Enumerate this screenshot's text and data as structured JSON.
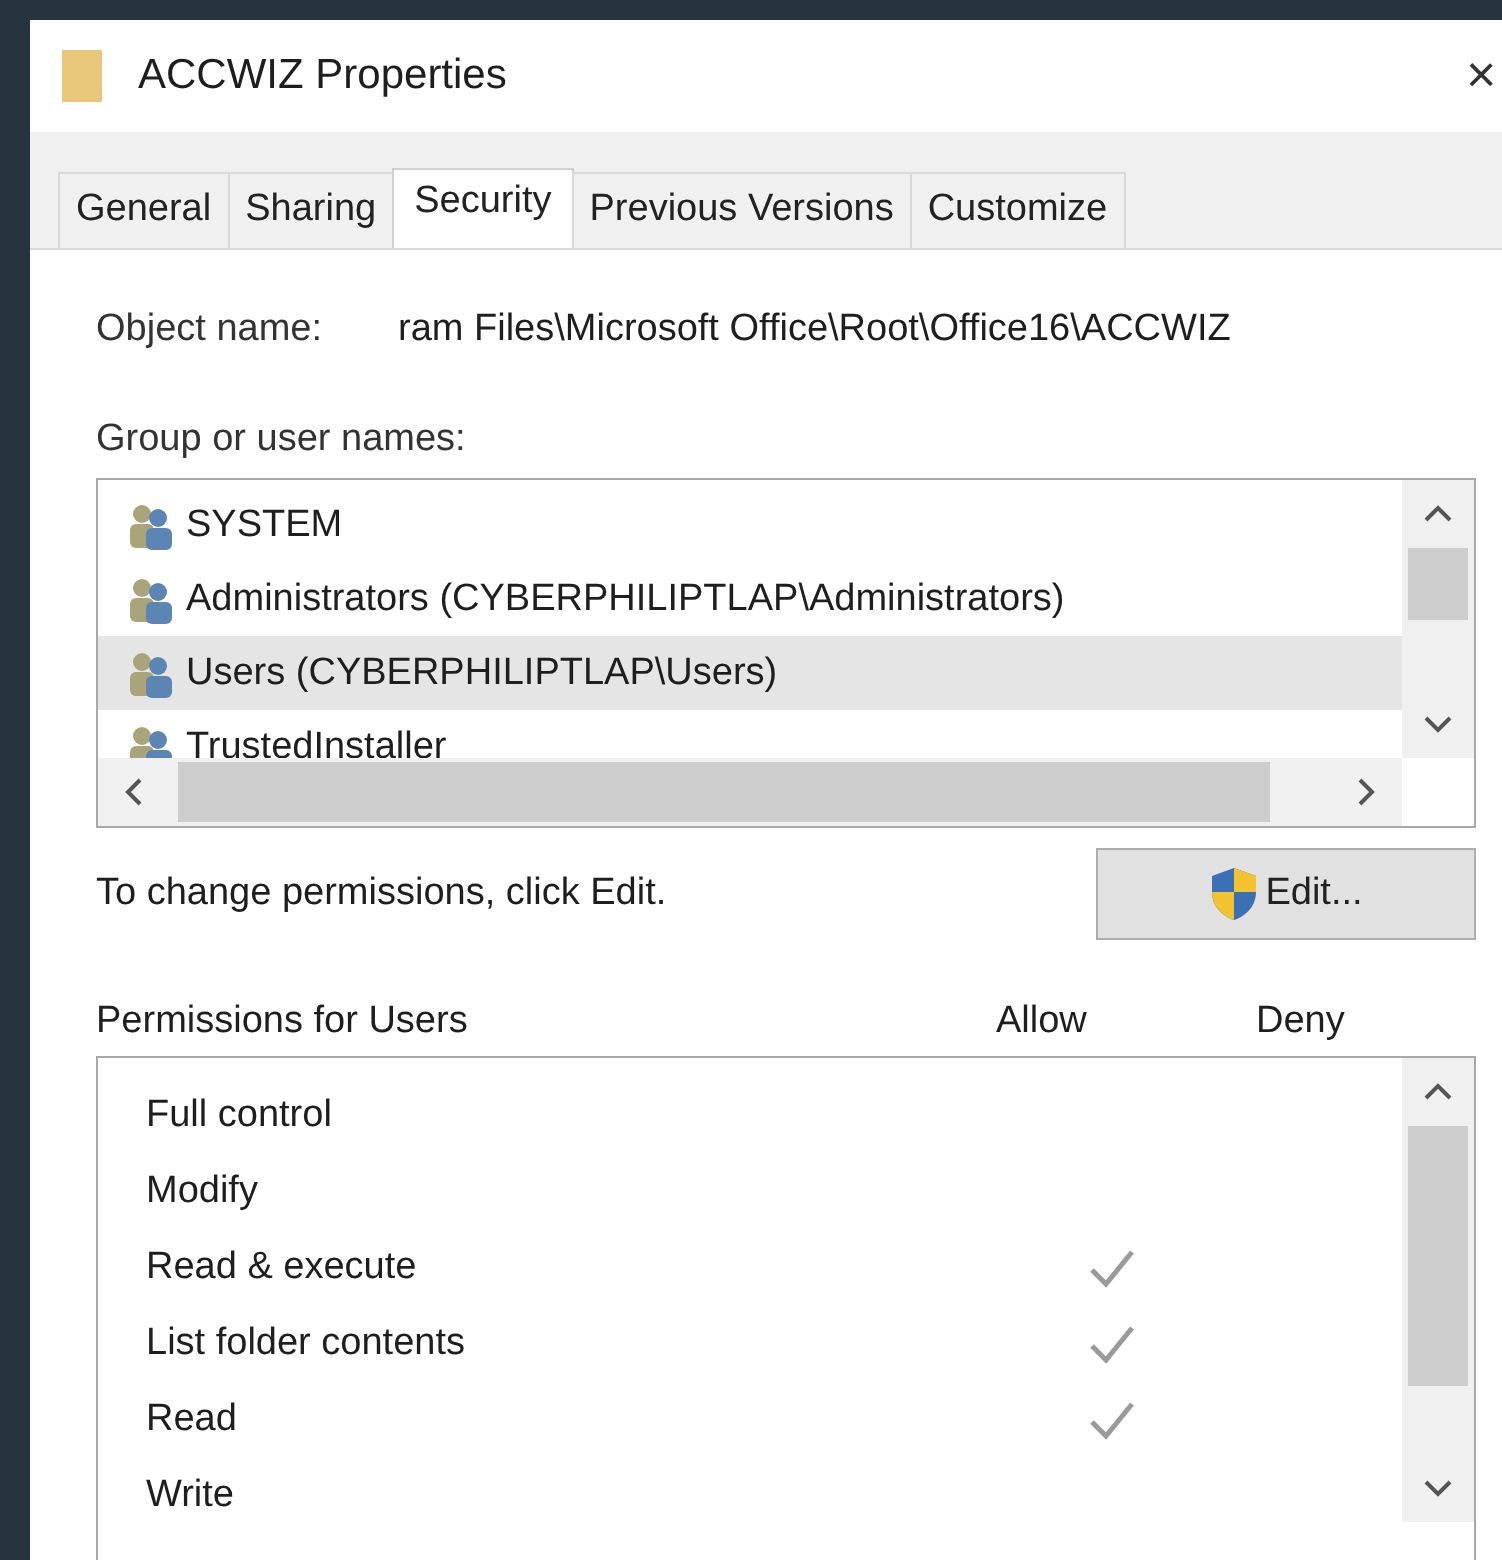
{
  "window": {
    "title": "ACCWIZ Properties",
    "close": "×"
  },
  "tabs": [
    {
      "label": "General",
      "selected": false
    },
    {
      "label": "Sharing",
      "selected": false
    },
    {
      "label": "Security",
      "selected": true
    },
    {
      "label": "Previous Versions",
      "selected": false
    },
    {
      "label": "Customize",
      "selected": false
    }
  ],
  "object_name": {
    "label": "Object name:",
    "value": "ram Files\\Microsoft Office\\Root\\Office16\\ACCWIZ"
  },
  "group_list": {
    "label": "Group or user names:",
    "items": [
      {
        "name": "SYSTEM",
        "selected": false
      },
      {
        "name": "Administrators (CYBERPHILIPTLAP\\Administrators)",
        "selected": false
      },
      {
        "name": "Users (CYBERPHILIPTLAP\\Users)",
        "selected": true
      },
      {
        "name": "TrustedInstaller",
        "selected": false
      }
    ]
  },
  "change_hint": "To change permissions, click Edit.",
  "edit_button": "Edit...",
  "permissions": {
    "label": "Permissions for Users",
    "allow_header": "Allow",
    "deny_header": "Deny",
    "rows": [
      {
        "name": "Full control",
        "allow": false,
        "deny": false
      },
      {
        "name": "Modify",
        "allow": false,
        "deny": false
      },
      {
        "name": "Read & execute",
        "allow": true,
        "deny": false
      },
      {
        "name": "List folder contents",
        "allow": true,
        "deny": false
      },
      {
        "name": "Read",
        "allow": true,
        "deny": false
      },
      {
        "name": "Write",
        "allow": false,
        "deny": false
      }
    ]
  }
}
